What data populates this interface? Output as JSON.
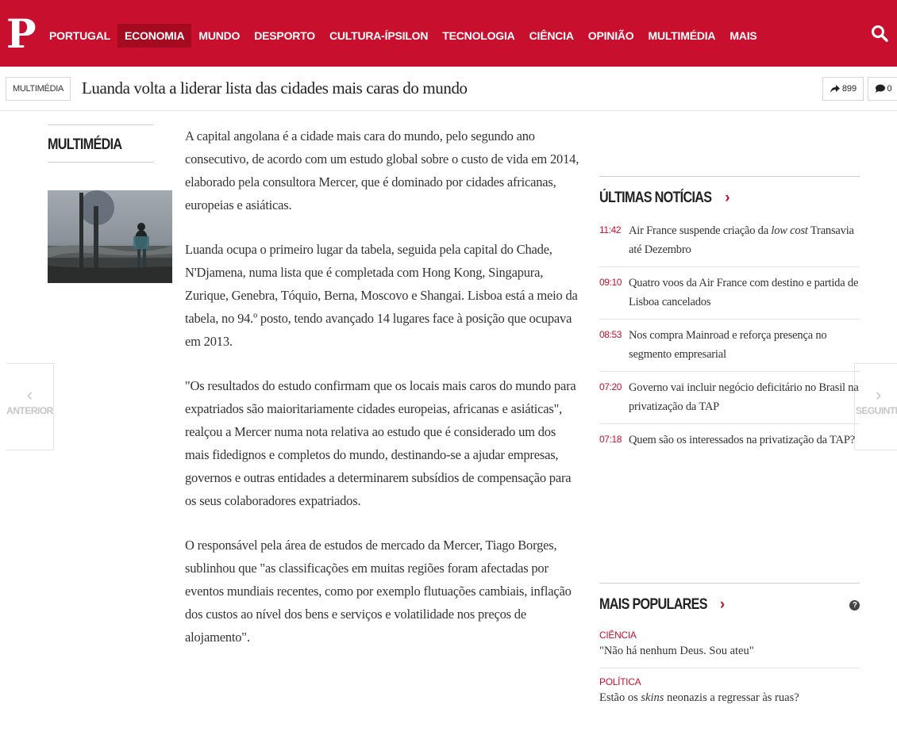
{
  "logo": "P",
  "nav": {
    "items": [
      "PORTUGAL",
      "ECONOMIA",
      "MUNDO",
      "DESPORTO",
      "CULTURA-ÍPSILON",
      "TECNOLOGIA",
      "CIÊNCIA",
      "OPINIÃO",
      "MULTIMÉDIA",
      "MAIS"
    ],
    "active": "ECONOMIA"
  },
  "titlebar": {
    "section": "MULTIMÉDIA",
    "headline": "Luanda volta a liderar lista das cidades mais caras do mundo",
    "shares": "899",
    "comments": "0"
  },
  "sidebar": {
    "heading": "MULTIMÉDIA"
  },
  "pager": {
    "prev": "ANTERIOR",
    "next": "SEGUINTE"
  },
  "article": {
    "paragraphs": [
      "A capital angolana é a cidade mais cara do mundo, pelo segundo ano consecutivo, de acordo com um estudo global sobre o custo de vida em 2014, elaborado pela consultora Mercer, que é dominado por cidades africanas, europeias e asiáticas.",
      "Luanda ocupa o primeiro lugar da tabela, seguida pela capital do Chade, N'Djamena, numa lista que é completada com Hong Kong, Singapura, Zurique, Genebra, Tóquio, Berna, Moscovo e Shangai. Lisboa está a meio da tabela, no 94.º posto, tendo avançado 14 lugares face à posição que ocupava em 2013.",
      "\"Os resultados do estudo confirmam que os locais mais caros do mundo para expatriados são maioritariamente cidades europeias, africanas e asiáticas\", realçou a Mercer numa nota relativa ao estudo que é considerado um dos mais fidedignos e completos do mundo, destinando-se a ajudar empresas, governos e outras entidades a determinarem subsídios de compensação para os seus colaboradores expatriados.",
      "O responsável pela área de estudos de mercado da Mercer, Tiago Borges, sublinhou que \"as classificações em muitas regiões foram afectadas por eventos mundiais recentes, como por exemplo flutuações cambiais, inflação dos custos ao nível dos bens e serviços e volatilidade nos preços de alojamento\"."
    ]
  },
  "latest": {
    "heading": "ÚLTIMAS NOTÍCIAS",
    "arrow": "›",
    "items": [
      {
        "time": "11:42",
        "pre": "Air France suspende criação da ",
        "em": "low cost",
        "post": " Transavia até Dezembro"
      },
      {
        "time": "09:10",
        "pre": "Quatro voos da Air France com destino e partida de Lisboa cancelados",
        "em": "",
        "post": ""
      },
      {
        "time": "08:53",
        "pre": "Nos compra Mainroad e reforça presença no segmento empresarial",
        "em": "",
        "post": ""
      },
      {
        "time": "07:20",
        "pre": "Governo vai incluir negócio deficitário no Brasil na privatização da TAP",
        "em": "",
        "post": ""
      },
      {
        "time": "07:18",
        "pre": "Quem são os interessados na privatização da TAP?",
        "em": "",
        "post": ""
      }
    ]
  },
  "popular": {
    "heading": "MAIS POPULARES",
    "arrow": "›",
    "help": "?",
    "items": [
      {
        "category": "CIÊNCIA",
        "pre": "\"Não há nenhum Deus. Sou ateu\"",
        "em": "",
        "post": ""
      },
      {
        "category": "POLÍTICA",
        "pre": "Estão os ",
        "em": "skins",
        "post": " neonazis a regressar às ruas?"
      }
    ]
  },
  "colors": {
    "brand": "#c8102e",
    "brand_active": "#a40a20"
  }
}
